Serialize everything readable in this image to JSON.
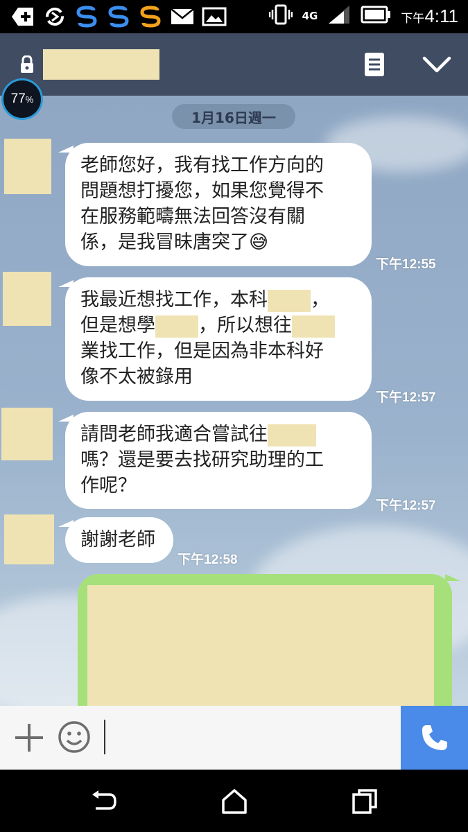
{
  "status_bar": {
    "time_prefix": "下午",
    "time": "4:11",
    "network": "4G",
    "icons": [
      "add-icon",
      "sync-icon",
      "s-app-icon",
      "s-app-icon",
      "s-app-icon-orange",
      "mail-icon",
      "image-icon",
      "vibrate-icon",
      "signal-icon",
      "battery-icon"
    ]
  },
  "header": {
    "contact_name": "",
    "icons": [
      "lock-icon",
      "memo-icon",
      "chevron-down-icon"
    ]
  },
  "battery_widget": {
    "value": "77",
    "unit": "%"
  },
  "chat": {
    "date_divider": "1月16日週一",
    "messages": [
      {
        "id": "m1",
        "lines": [
          "老師您好，我有找工作方向的",
          "問題想打擾您，如果您覺得不",
          "在服務範疇無法回答沒有關",
          "係，是我冒昧唐突了"
        ],
        "emoji": "😅",
        "time": "下午12:55"
      },
      {
        "id": "m2",
        "line1_a": "我最近想找工作，本科",
        "line1_b": "，",
        "line2_a": "但是想學",
        "line2_b": "，所以想往",
        "line3": "業找工作，但是因為非本科好",
        "line4": "像不太被錄用",
        "time": "下午12:57"
      },
      {
        "id": "m3",
        "line1": "請問老師我適合嘗試往",
        "line2": "嗎？還是要去找研究助理的工",
        "line3": "作呢？",
        "time": "下午12:57"
      },
      {
        "id": "m4",
        "text": "謝謝老師",
        "time": "下午12:58"
      }
    ]
  },
  "colors": {
    "header_bg": "#3f4c62",
    "chat_bg": "#93abc6",
    "sent_bubble": "#a6e07a",
    "call_button": "#4a8ae8",
    "redaction": "#efe3b4"
  },
  "input_bar": {
    "icons": [
      "plus-icon",
      "smiley-icon",
      "phone-icon"
    ]
  },
  "nav_bar": {
    "icons": [
      "back-icon",
      "home-icon",
      "recents-icon"
    ]
  }
}
